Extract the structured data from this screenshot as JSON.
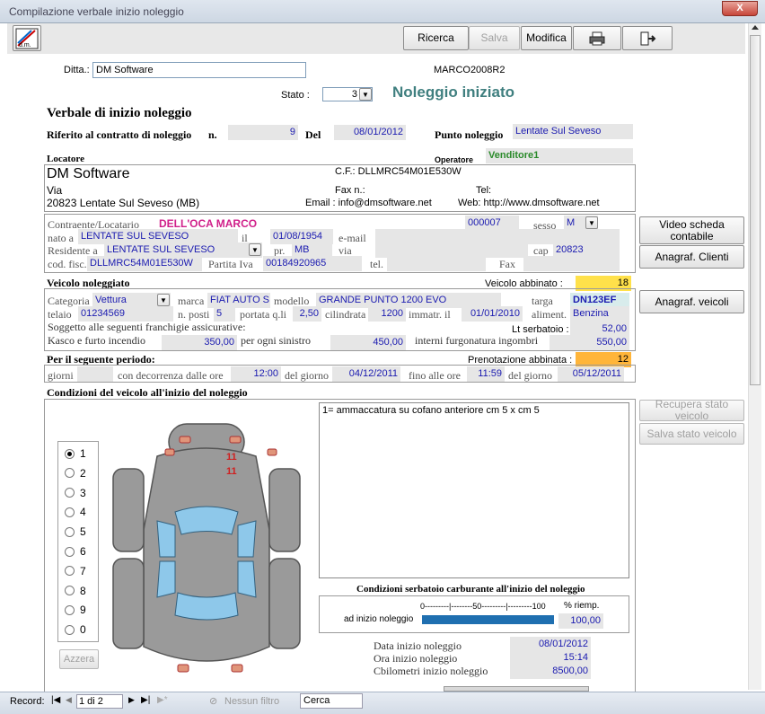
{
  "window": {
    "title": "Compilazione verbale inizio noleggio",
    "close_glyph": "X"
  },
  "toolbar": {
    "ricerca": "Ricerca",
    "salva": "Salva",
    "modifica": "Modifica",
    "print_icon": "printer-icon",
    "exit_icon": "exit-door-icon",
    "logo_text": "d.m."
  },
  "header": {
    "ditta_label": "Ditta.:",
    "ditta_value": "DM Software",
    "code": "MARCO2008R2",
    "stato_label": "Stato :",
    "stato_value": "3",
    "status_title": "Noleggio iniziato",
    "status_color": "#3f7f7f"
  },
  "form": {
    "title": "Verbale di inizio noleggio",
    "rif_label": "Riferito al contratto di noleggio",
    "n_label": "n.",
    "n_value": "9",
    "del_label": "Del",
    "del_value": "08/01/2012",
    "punto_label": "Punto noleggio",
    "punto_value": "Lentate Sul Seveso"
  },
  "locatore": {
    "label": "Locatore",
    "operatore_label": "Operatore",
    "operatore_value": "Venditore1",
    "name": "DM Software",
    "cf": "C.F.: DLLMRC54M01E530W",
    "via": "Via",
    "fax": "Fax n.:",
    "tel": "Tel:",
    "city": "20823 Lentate Sul Seveso (MB)",
    "email": "Email : info@dmsoftware.net",
    "web": "Web: http://www.dmsoftware.net"
  },
  "contraente": {
    "label": "Contraente/Locatario",
    "name": "DELL'OCA MARCO",
    "code": "000007",
    "sesso_label": "sesso",
    "sesso_value": "M",
    "nato_label": "nato a",
    "nato_value": "LENTATE SUL SEVESO",
    "il_label": "il",
    "il_value": "01/08/1954",
    "email_label": "e-mail",
    "res_label": "Residente a",
    "res_value": "LENTATE SUL SEVESO",
    "pr_label": "pr.",
    "pr_value": "MB",
    "via_label": "via",
    "cap_label": "cap",
    "cap_value": "20823",
    "cf_label": "cod. fisc.",
    "cf_value": "DLLMRC54M01E530W",
    "piva_label": "Partita Iva",
    "piva_value": "00184920965",
    "tel_label": "tel.",
    "fax_label": "Fax"
  },
  "veicolo": {
    "label": "Veicolo noleggiato",
    "abbinato_label": "Veicolo abbinato :",
    "abbinato_value": "18",
    "categoria_label": "Categoria",
    "categoria_value": "Vettura",
    "marca_label": "marca",
    "marca_value": "FIAT AUTO S",
    "modello_label": "modello",
    "modello_value": "GRANDE PUNTO 1200 EVO",
    "targa_label": "targa",
    "targa_value": "DN123EF",
    "telaio_label": "telaio",
    "telaio_value": "01234569",
    "posti_label": "n. posti",
    "posti_value": "5",
    "portata_label": "portata q.li",
    "portata_value": "2,50",
    "cil_label": "cilindrata",
    "cil_value": "1200",
    "immatr_label": "immatr. il",
    "immatr_value": "01/01/2010",
    "alim_label": "aliment.",
    "alim_value": "Benzina",
    "soggetto": "Soggetto alle seguenti franchigie assicurative:",
    "lt_label": "Lt serbatoio :",
    "lt_value": "52,00",
    "kasco_label": "Kasco e furto incendio",
    "kasco_value": "350,00",
    "sinistro_label": "per ogni sinistro",
    "sinistro_value": "450,00",
    "interni_label": "interni furgonatura ingombri",
    "interni_value": "550,00"
  },
  "periodo": {
    "label": "Per il seguente periodo:",
    "pren_label": "Prenotazione abbinata :",
    "pren_value": "12",
    "giorni_label": "giorni",
    "decorrenza_label": "con decorrenza dalle ore",
    "ore1": "12:00",
    "del_giorno_label": "del giorno",
    "giorno1": "04/12/2011",
    "fino_label": "fino alle ore",
    "ore2": "11:59",
    "del_giorno2_label": "del giorno",
    "giorno2": "05/12/2011"
  },
  "condizioni": {
    "label": "Condizioni del veicolo all'inizio del noleggio",
    "notes": "1= ammaccatura su cofano anteriore cm 5 x cm 5",
    "damage_marks": [
      "11",
      "11"
    ],
    "radios": [
      "1",
      "2",
      "3",
      "4",
      "5",
      "6",
      "7",
      "8",
      "9",
      "0"
    ],
    "selected": "1",
    "azzera": "Azzera",
    "serbatoio_title": "Condizioni serbatoio carburante all'inizio del noleggio",
    "scale": "0---------|--------50---------|---------100",
    "riemp_label": "% riemp.",
    "inizio_label": "ad inizio noleggio",
    "riemp_value": "100,00",
    "fuel_fraction": 1.0,
    "data_label": "Data inizio noleggio",
    "data_value": "08/01/2012",
    "ora_label": "Ora inizio noleggio",
    "ora_value": "15:14",
    "km_label": "Cbilometri inizio noleggio",
    "km_value": "8500,00"
  },
  "side": {
    "video": "Video scheda contabile",
    "clienti": "Anagraf. Clienti",
    "veicoli": "Anagraf. veicoli",
    "recupera": "Recupera stato veicolo",
    "salva_stato": "Salva stato veicolo"
  },
  "status": {
    "record_label": "Record:",
    "record_value": "1 di 2",
    "filtro": "Nessun filtro",
    "cerca": "Cerca"
  }
}
